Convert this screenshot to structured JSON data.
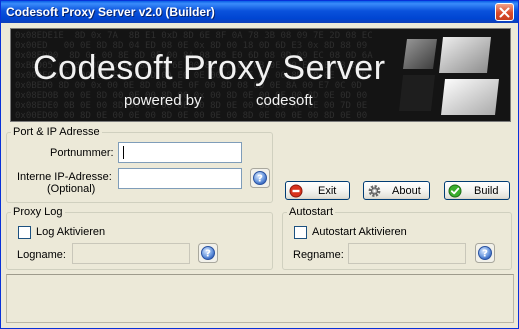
{
  "window": {
    "title": "Codesoft Proxy Server v2.0 (Builder)"
  },
  "banner": {
    "title": "Codesoft Proxy Server",
    "powered_by": "powered by",
    "brand": "codesoft"
  },
  "port_ip_group": {
    "legend": "Port & IP Adresse",
    "port_label": "Portnummer:",
    "port_value": "",
    "ip_label_line1": "Interne IP-Adresse:",
    "ip_label_line2": "(Optional)",
    "ip_value": ""
  },
  "actions": {
    "exit_label": "Exit",
    "about_label": "About",
    "build_label": "Build"
  },
  "proxy_log_group": {
    "legend": "Proxy Log",
    "checkbox_label": "Log Aktivieren",
    "checked": false,
    "logname_label": "Logname:",
    "logname_value": ""
  },
  "autostart_group": {
    "legend": "Autostart",
    "checkbox_label": "Autostart Aktivieren",
    "checked": false,
    "regname_label": "Regname:",
    "regname_value": ""
  },
  "status": {
    "text": ""
  }
}
